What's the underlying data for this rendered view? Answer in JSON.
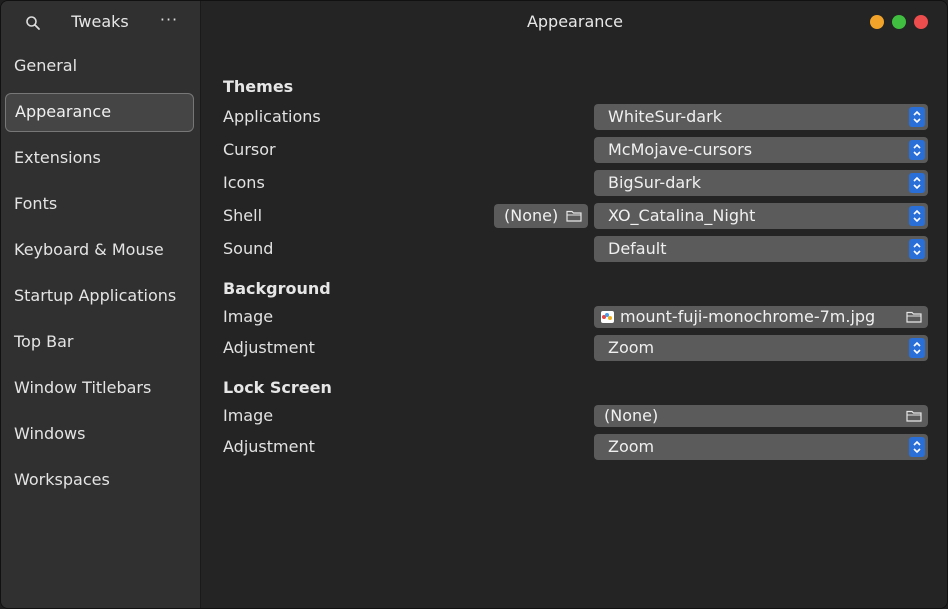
{
  "sidebar": {
    "title": "Tweaks",
    "menu_label": "···",
    "items": [
      {
        "label": "General"
      },
      {
        "label": "Appearance"
      },
      {
        "label": "Extensions"
      },
      {
        "label": "Fonts"
      },
      {
        "label": "Keyboard & Mouse"
      },
      {
        "label": "Startup Applications"
      },
      {
        "label": "Top Bar"
      },
      {
        "label": "Window Titlebars"
      },
      {
        "label": "Windows"
      },
      {
        "label": "Workspaces"
      }
    ],
    "active_index": 1
  },
  "header": {
    "title": "Appearance"
  },
  "themes": {
    "title": "Themes",
    "applications": {
      "label": "Applications",
      "value": "WhiteSur-dark"
    },
    "cursor": {
      "label": "Cursor",
      "value": "McMojave-cursors"
    },
    "icons": {
      "label": "Icons",
      "value": "BigSur-dark"
    },
    "shell": {
      "label": "Shell",
      "file_value": "(None)",
      "value": "XO_Catalina_Night"
    },
    "sound": {
      "label": "Sound",
      "value": "Default"
    }
  },
  "background": {
    "title": "Background",
    "image": {
      "label": "Image",
      "value": "mount-fuji-monochrome-7m.jpg"
    },
    "adjustment": {
      "label": "Adjustment",
      "value": "Zoom"
    }
  },
  "lock_screen": {
    "title": "Lock Screen",
    "image": {
      "label": "Image",
      "value": "(None)"
    },
    "adjustment": {
      "label": "Adjustment",
      "value": "Zoom"
    }
  },
  "colors": {
    "accent": "#2a6fd8",
    "minimize": "#f2a42a",
    "maximize": "#3fbe3f",
    "close": "#ee4d4d"
  }
}
